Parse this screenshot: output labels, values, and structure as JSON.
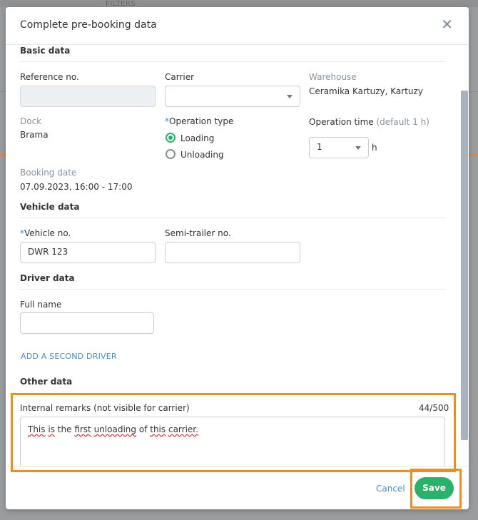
{
  "background": {
    "tab_label": "FILTERS"
  },
  "dialog": {
    "title": "Complete pre-booking data",
    "close_glyph": "✕"
  },
  "basic": {
    "title": "Basic data",
    "reference_label": "Reference no.",
    "reference_value": "",
    "carrier_label": "Carrier",
    "carrier_value": "",
    "warehouse_label": "Warehouse",
    "warehouse_value": "Ceramika Kartuzy, Kartuzy",
    "dock_label": "Dock",
    "dock_value": "Brama",
    "operation_type_label": "Operation type",
    "operation_options": [
      "Loading",
      "Unloading"
    ],
    "operation_selected": "Loading",
    "operation_time_label": "Operation time",
    "operation_time_hint": "(default 1 h)",
    "operation_time_value": "1",
    "operation_time_unit": "h",
    "booking_date_label": "Booking date",
    "booking_date_value": "07.09.2023, 16:00 - 17:00"
  },
  "vehicle": {
    "title": "Vehicle data",
    "vehicle_label": "Vehicle no.",
    "vehicle_value": "DWR 123",
    "semitrailer_label": "Semi-trailer no.",
    "semitrailer_value": ""
  },
  "driver": {
    "title": "Driver data",
    "full_name_label": "Full name",
    "full_name_value": "",
    "add_driver_link": "ADD A SECOND DRIVER"
  },
  "other": {
    "title": "Other data",
    "remarks_label": "Internal remarks (not visible for carrier)",
    "remarks_counter": "44/500",
    "remarks_words": [
      "This",
      "is",
      "the",
      "first",
      "unloading",
      "of",
      "this",
      "carrier."
    ]
  },
  "footer": {
    "cancel_label": "Cancel",
    "save_label": "Save"
  },
  "colors": {
    "accent_green": "#2bb26a",
    "link_blue": "#4a8bc8",
    "highlight_orange": "#f28c1c"
  }
}
